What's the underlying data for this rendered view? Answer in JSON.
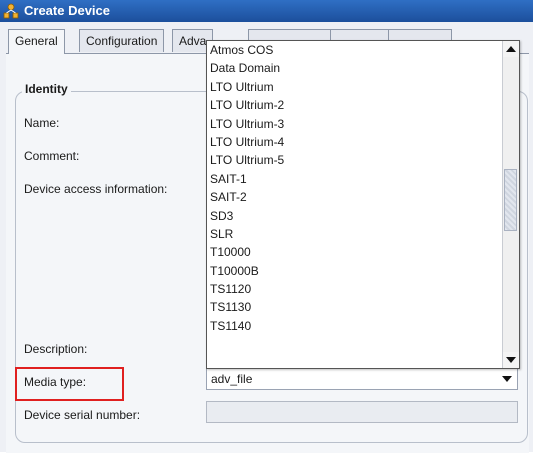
{
  "window": {
    "title": "Create Device"
  },
  "tabs": [
    {
      "label": "General"
    },
    {
      "label": "Configuration"
    },
    {
      "label": "Adva"
    }
  ],
  "identity": {
    "group_title": "Identity",
    "name_label": "Name:",
    "comment_label": "Comment:",
    "device_access_label": "Device access information:",
    "description_label": "Description:",
    "media_type_label": "Media type:",
    "media_type_value": "adv_file",
    "serial_label": "Device serial number:"
  },
  "dropdown": {
    "options": [
      "Atmos COS",
      "Data Domain",
      "LTO Ultrium",
      "LTO Ultrium-2",
      "LTO Ultrium-3",
      "LTO Ultrium-4",
      "LTO Ultrium-5",
      "SAIT-1",
      "SAIT-2",
      "SD3",
      "SLR",
      "T10000",
      "T10000B",
      "TS1120",
      "TS1130",
      "TS1140"
    ]
  },
  "colors": {
    "title_bar": "#1c4f9c",
    "highlight_border": "#e02020"
  },
  "icons": {
    "app": "device-tree-icon",
    "select_arrow": "chevron-down-icon",
    "scroll_up": "arrow-up-icon",
    "scroll_down": "arrow-down-icon"
  }
}
